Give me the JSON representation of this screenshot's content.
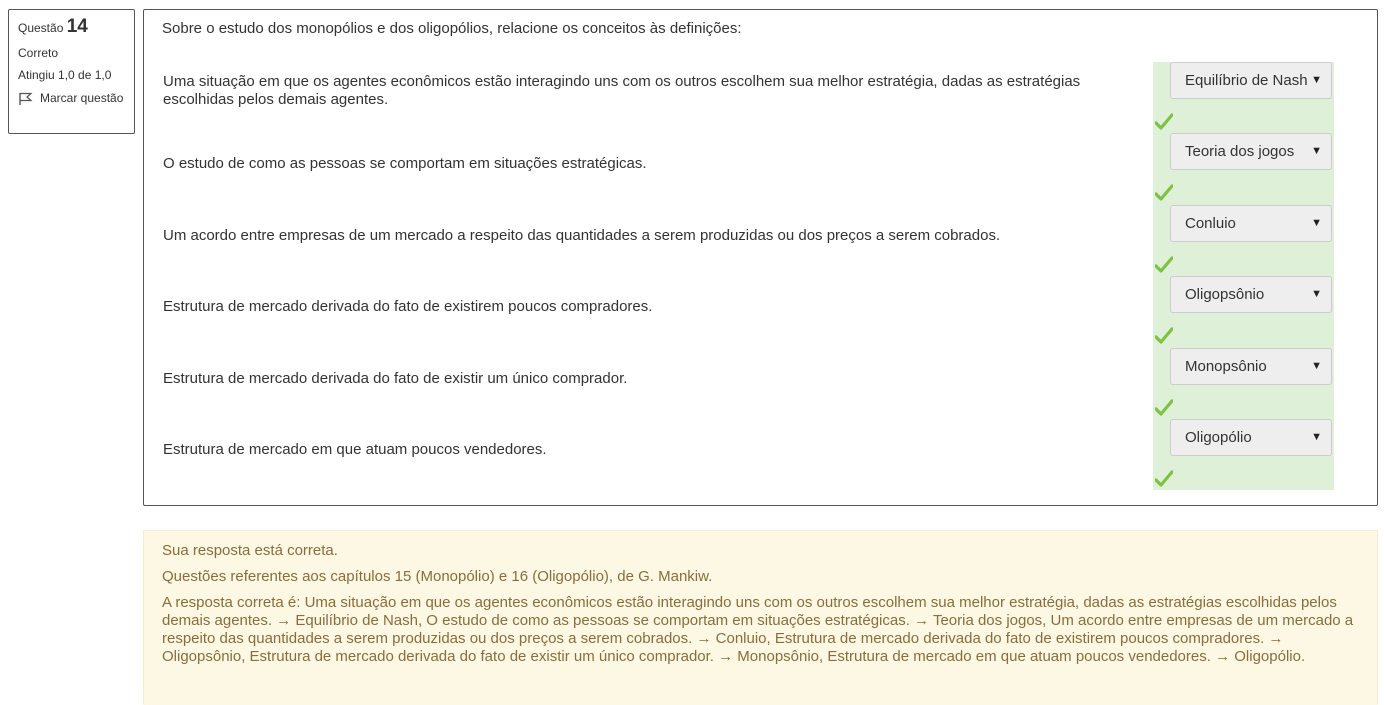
{
  "info": {
    "question_label": "Questão",
    "question_number": "14",
    "status": "Correto",
    "grade": "Atingiu 1,0 de 1,0",
    "flag_label": "Marcar questão"
  },
  "question": {
    "prompt": "Sobre o estudo dos monopólios e dos oligopólios, relacione os conceitos às definições:",
    "rows": [
      {
        "text": "Uma situação em que os agentes econômicos estão interagindo uns com os outros escolhem sua melhor estratégia, dadas as estratégias escolhidas pelos demais agentes.",
        "answer": "Equilíbrio de Nash"
      },
      {
        "text": "O estudo de como as pessoas se comportam em situações estratégicas.",
        "answer": "Teoria dos jogos"
      },
      {
        "text": "Um acordo entre empresas de um mercado a respeito das quantidades a serem produzidas ou dos preços a serem cobrados.",
        "answer": "Conluio"
      },
      {
        "text": "Estrutura de mercado derivada do fato de existirem poucos compradores.",
        "answer": "Oligopsônio"
      },
      {
        "text": "Estrutura de mercado derivada do fato de existir um único comprador.",
        "answer": "Monopsônio"
      },
      {
        "text": "Estrutura de mercado em que atuam poucos vendedores.",
        "answer": "Oligopólio"
      }
    ]
  },
  "feedback": {
    "result": "Sua resposta está correta.",
    "reference": "Questões referentes aos capítulos 15 (Monopólio) e 16 (Oligopólio), de G. Mankiw.",
    "correct_answer": "A resposta correta é: Uma situação em que os agentes econômicos estão interagindo uns com os outros escolhem sua melhor estratégia, dadas as estratégias escolhidas pelos demais agentes. → Equilíbrio de Nash, O estudo de como as pessoas se comportam em situações estratégicas. → Teoria dos jogos, Um acordo entre empresas de um mercado a respeito das quantidades a serem produzidas ou dos preços a serem cobrados. → Conluio, Estrutura de mercado derivada do fato de existirem poucos compradores. → Oligopsônio, Estrutura de mercado derivada do fato de existir um único comprador. → Monopsônio, Estrutura de mercado em que atuam poucos vendedores. → Oligopólio."
  },
  "colors": {
    "correct_bg": "#dff0d8",
    "check": "#7dc242",
    "feedback_bg": "#fcf8e3",
    "feedback_text": "#8a6d3b"
  },
  "icons": {
    "flag": "flag-icon",
    "check": "check-icon",
    "dropdown": "dropdown-arrow-icon"
  }
}
